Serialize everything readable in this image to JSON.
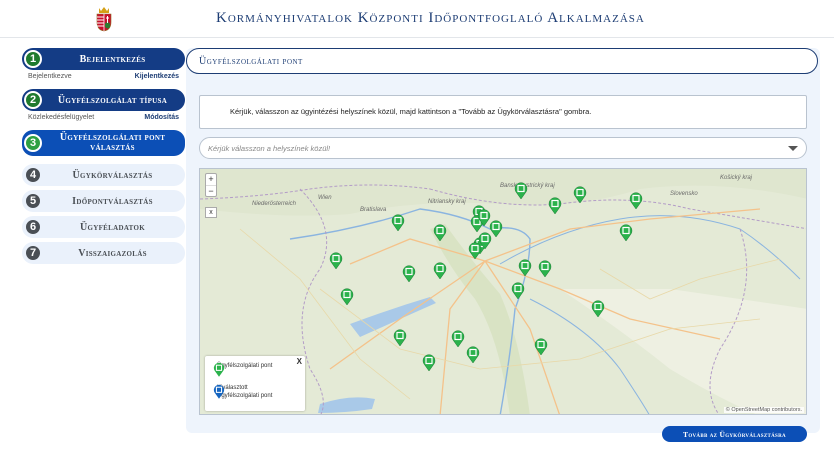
{
  "app": {
    "title": "Kormányhivatalok Központi Időpontfoglaló Alkalmazása"
  },
  "colors": {
    "primary": "#143c85",
    "active": "#0c4fb6",
    "marker": "#2bb24c",
    "selected_marker": "#1565c0"
  },
  "steps": [
    {
      "num": "1",
      "label": "Bejelentkezés",
      "state": "done",
      "sub_left": "Bejelentkezve",
      "sub_right": "Kijelentkezés"
    },
    {
      "num": "2",
      "label": "Ügyfélszolgálat típusa",
      "state": "done",
      "sub_left": "Közlekedésfelügyelet",
      "sub_right": "Módosítás"
    },
    {
      "num": "3",
      "label": "Ügyfélszolgálati pont választás",
      "state": "active"
    },
    {
      "num": "4",
      "label": "Ügykörválasztás",
      "state": "todo"
    },
    {
      "num": "5",
      "label": "Időpontválasztás",
      "state": "todo"
    },
    {
      "num": "6",
      "label": "Ügyféladatok",
      "state": "todo"
    },
    {
      "num": "7",
      "label": "Visszaigazolás",
      "state": "todo"
    }
  ],
  "section": {
    "title": "Ügyfélszolgálati pont"
  },
  "info": {
    "text": "Kérjük, válasszon az ügyintézési helyszínek közül, majd kattintson a \"Tovább az Ügykörválasztásra\" gombra."
  },
  "select": {
    "placeholder": "Kérjük válasszon a helyszínek közül!"
  },
  "map": {
    "zoom_in": "+",
    "zoom_out": "−",
    "close": "x",
    "labels": [
      "Wien",
      "Niederösterreich",
      "Bratislava",
      "Nitriansky kraj",
      "Banskobystrický kraj",
      "Slovensko",
      "Košický kraj"
    ],
    "legend": {
      "close": "X",
      "item1": "Ügyfélszolgálati pont",
      "item2_line1": "Kiválasztott",
      "item2_line2": "Ügyfélszolgálati pont"
    },
    "attribution": "© OpenStreetMap contributors."
  },
  "next_button": "Tovább az Ügykörválasztásra"
}
